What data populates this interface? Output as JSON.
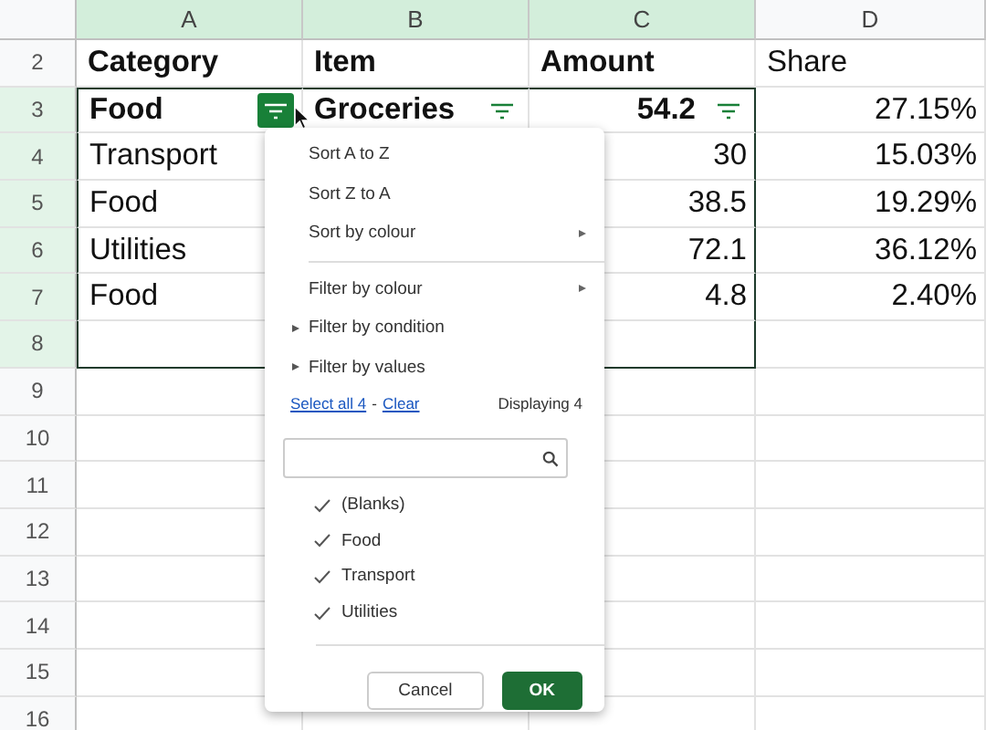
{
  "columns": [
    {
      "label": "A",
      "selected": true
    },
    {
      "label": "B",
      "selected": true
    },
    {
      "label": "C",
      "selected": true
    },
    {
      "label": "D",
      "selected": false
    }
  ],
  "rows": [
    {
      "number": "2",
      "selected": false,
      "cells": [
        {
          "text": "Category",
          "bold": true
        },
        {
          "text": "Item",
          "bold": true
        },
        {
          "text": "Amount",
          "bold": true
        },
        {
          "text": "Share",
          "bold": false
        }
      ]
    },
    {
      "number": "3",
      "selected": true,
      "cells": [
        {
          "text": "Food",
          "bold": true,
          "filter": true,
          "filter_active": true
        },
        {
          "text": "Groceries",
          "bold": true,
          "filter": true,
          "filter_active": false
        },
        {
          "text": "54.2",
          "bold": true,
          "filter": true,
          "filter_active": false
        },
        {
          "text": "27.15%",
          "bold": false
        }
      ]
    },
    {
      "number": "4",
      "selected": true,
      "cells": [
        {
          "text": "Transport",
          "bold": false
        },
        {},
        {
          "text": "30",
          "bold": false
        },
        {
          "text": "15.03%",
          "bold": false
        }
      ]
    },
    {
      "number": "5",
      "selected": true,
      "cells": [
        {
          "text": "Food",
          "bold": false
        },
        {},
        {
          "text": "38.5",
          "bold": false
        },
        {
          "text": "19.29%",
          "bold": false
        }
      ]
    },
    {
      "number": "6",
      "selected": true,
      "cells": [
        {
          "text": "Utilities",
          "bold": false
        },
        {},
        {
          "text": "72.1",
          "bold": false
        },
        {
          "text": "36.12%",
          "bold": false
        }
      ]
    },
    {
      "number": "7",
      "selected": true,
      "cells": [
        {
          "text": "Food",
          "bold": false
        },
        {},
        {
          "text": "4.8",
          "bold": false
        },
        {
          "text": "2.40%",
          "bold": false
        }
      ]
    },
    {
      "number": "8",
      "selected": true,
      "cells": [
        {},
        {},
        {},
        {}
      ]
    },
    {
      "number": "9",
      "selected": false,
      "cells": [
        {},
        {},
        {},
        {}
      ]
    },
    {
      "number": "10",
      "selected": false,
      "cells": [
        {},
        {},
        {},
        {}
      ]
    },
    {
      "number": "11",
      "selected": false,
      "cells": [
        {},
        {},
        {},
        {}
      ]
    },
    {
      "number": "12",
      "selected": false,
      "cells": [
        {},
        {},
        {},
        {}
      ]
    },
    {
      "number": "13",
      "selected": false,
      "cells": [
        {},
        {},
        {},
        {}
      ]
    },
    {
      "number": "14",
      "selected": false,
      "cells": [
        {},
        {},
        {},
        {}
      ]
    },
    {
      "number": "15",
      "selected": false,
      "cells": [
        {},
        {},
        {},
        {}
      ]
    },
    {
      "number": "16",
      "selected": false,
      "cells": [
        {},
        {},
        {},
        {}
      ]
    }
  ],
  "filter_menu": {
    "items": [
      {
        "kind": "item",
        "label": "Sort A to Z"
      },
      {
        "kind": "item",
        "label": "Sort Z to A"
      },
      {
        "kind": "submenu",
        "label": "Sort by colour"
      },
      {
        "kind": "separator"
      },
      {
        "kind": "submenu",
        "label": "Filter by colour"
      },
      {
        "kind": "section",
        "label": "Filter by condition",
        "expanded": false
      },
      {
        "kind": "section",
        "label": "Filter by values",
        "expanded": false
      }
    ],
    "select_all": "Select all 4",
    "dash": "-",
    "clear": "Clear",
    "displaying": "Displaying 4",
    "values": [
      {
        "label": "(Blanks)",
        "checked": true
      },
      {
        "label": "Food",
        "checked": true
      },
      {
        "label": "Transport",
        "checked": true
      },
      {
        "label": "Utilities",
        "checked": true
      }
    ],
    "buttons": [
      {
        "kind": "secondary",
        "label": "Cancel"
      },
      {
        "kind": "primary",
        "label": "OK"
      }
    ]
  }
}
